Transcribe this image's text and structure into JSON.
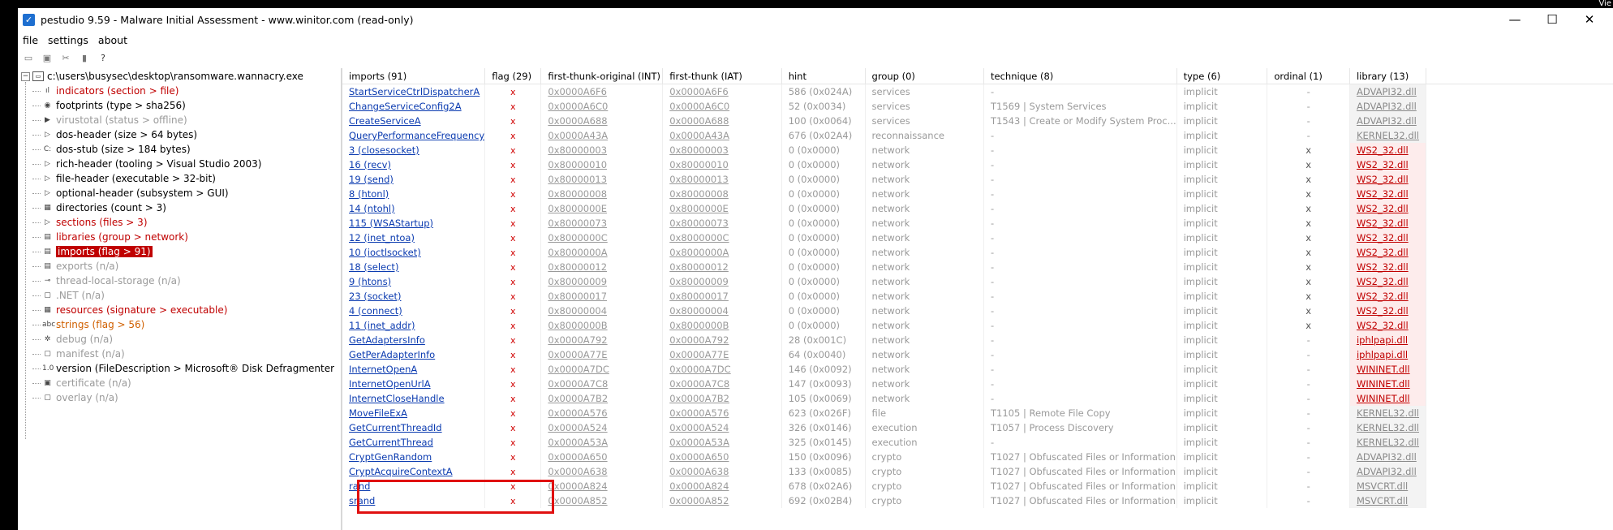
{
  "window": {
    "title": "pestudio 9.59 - Malware Initial Assessment - www.winitor.com (read-only)",
    "corner_text": "Vie",
    "controls": {
      "minimize": "—",
      "maximize": "☐",
      "close": "✕"
    }
  },
  "menu": [
    "file",
    "settings",
    "about"
  ],
  "toolbar_icons": [
    "open-icon",
    "save-icon",
    "cut-icon",
    "delete-icon",
    "help-icon"
  ],
  "tree": {
    "root": "c:\\users\\busysec\\desktop\\ransomware.wannacry.exe",
    "items": [
      {
        "label": "indicators (section > file)",
        "color": "red",
        "icon": "ıl"
      },
      {
        "label": "footprints (type > sha256)",
        "color": "black",
        "icon": "◉"
      },
      {
        "label": "virustotal (status > offline)",
        "color": "grey",
        "icon": "▶"
      },
      {
        "label": "dos-header (size > 64 bytes)",
        "color": "black",
        "icon": "▷"
      },
      {
        "label": "dos-stub (size > 184 bytes)",
        "color": "black",
        "icon": "C:"
      },
      {
        "label": "rich-header (tooling > Visual Studio 2003)",
        "color": "black",
        "icon": "▷"
      },
      {
        "label": "file-header (executable > 32-bit)",
        "color": "black",
        "icon": "▷"
      },
      {
        "label": "optional-header (subsystem > GUI)",
        "color": "black",
        "icon": "▷"
      },
      {
        "label": "directories (count > 3)",
        "color": "black",
        "icon": "▦"
      },
      {
        "label": "sections (files > 3)",
        "color": "red",
        "icon": "▷"
      },
      {
        "label": "libraries (group > network)",
        "color": "red",
        "icon": "▤"
      },
      {
        "label": "imports (flag > 91)",
        "color": "selected",
        "icon": "▤"
      },
      {
        "label": "exports (n/a)",
        "color": "grey",
        "icon": "▤"
      },
      {
        "label": "thread-local-storage (n/a)",
        "color": "grey",
        "icon": "⊸"
      },
      {
        "label": ".NET (n/a)",
        "color": "grey",
        "icon": "▢"
      },
      {
        "label": "resources (signature > executable)",
        "color": "red",
        "icon": "▦"
      },
      {
        "label": "strings (flag > 56)",
        "color": "orange",
        "icon": "abc"
      },
      {
        "label": "debug (n/a)",
        "color": "grey",
        "icon": "✲"
      },
      {
        "label": "manifest (n/a)",
        "color": "grey",
        "icon": "▢"
      },
      {
        "label": "version (FileDescription > Microsoft® Disk Defragmenter)",
        "color": "black",
        "icon": "1.0"
      },
      {
        "label": "certificate (n/a)",
        "color": "grey",
        "icon": "▣"
      },
      {
        "label": "overlay (n/a)",
        "color": "grey",
        "icon": "▢"
      }
    ]
  },
  "table": {
    "columns": [
      "imports (91)",
      "flag (29)",
      "first-thunk-original (INT)",
      "first-thunk (IAT)",
      "hint",
      "group (0)",
      "technique (8)",
      "type (6)",
      "ordinal (1)",
      "library (13)"
    ],
    "flag_mark": "x",
    "rows": [
      [
        "StartServiceCtrlDispatcherA",
        "x",
        "0x0000A6F6",
        "0x0000A6F6",
        "586 (0x024A)",
        "services",
        "-",
        "implicit",
        "-",
        "ADVAPI32.dll",
        "grey"
      ],
      [
        "ChangeServiceConfig2A",
        "x",
        "0x0000A6C0",
        "0x0000A6C0",
        "52 (0x0034)",
        "services",
        "T1569 | System Services",
        "implicit",
        "-",
        "ADVAPI32.dll",
        "grey"
      ],
      [
        "CreateServiceA",
        "x",
        "0x0000A688",
        "0x0000A688",
        "100 (0x0064)",
        "services",
        "T1543 | Create or Modify System Proc...",
        "implicit",
        "-",
        "ADVAPI32.dll",
        "grey"
      ],
      [
        "QueryPerformanceFrequency",
        "x",
        "0x0000A43A",
        "0x0000A43A",
        "676 (0x02A4)",
        "reconnaissance",
        "-",
        "implicit",
        "-",
        "KERNEL32.dll",
        "grey"
      ],
      [
        "3 (closesocket)",
        "x",
        "0x80000003",
        "0x80000003",
        "0 (0x0000)",
        "network",
        "-",
        "implicit",
        "x",
        "WS2_32.dll",
        "red"
      ],
      [
        "16 (recv)",
        "x",
        "0x80000010",
        "0x80000010",
        "0 (0x0000)",
        "network",
        "-",
        "implicit",
        "x",
        "WS2_32.dll",
        "red"
      ],
      [
        "19 (send)",
        "x",
        "0x80000013",
        "0x80000013",
        "0 (0x0000)",
        "network",
        "-",
        "implicit",
        "x",
        "WS2_32.dll",
        "red"
      ],
      [
        "8 (htonl)",
        "x",
        "0x80000008",
        "0x80000008",
        "0 (0x0000)",
        "network",
        "-",
        "implicit",
        "x",
        "WS2_32.dll",
        "red"
      ],
      [
        "14 (ntohl)",
        "x",
        "0x8000000E",
        "0x8000000E",
        "0 (0x0000)",
        "network",
        "-",
        "implicit",
        "x",
        "WS2_32.dll",
        "red"
      ],
      [
        "115 (WSAStartup)",
        "x",
        "0x80000073",
        "0x80000073",
        "0 (0x0000)",
        "network",
        "-",
        "implicit",
        "x",
        "WS2_32.dll",
        "red"
      ],
      [
        "12 (inet_ntoa)",
        "x",
        "0x8000000C",
        "0x8000000C",
        "0 (0x0000)",
        "network",
        "-",
        "implicit",
        "x",
        "WS2_32.dll",
        "red"
      ],
      [
        "10 (ioctlsocket)",
        "x",
        "0x8000000A",
        "0x8000000A",
        "0 (0x0000)",
        "network",
        "-",
        "implicit",
        "x",
        "WS2_32.dll",
        "red"
      ],
      [
        "18 (select)",
        "x",
        "0x80000012",
        "0x80000012",
        "0 (0x0000)",
        "network",
        "-",
        "implicit",
        "x",
        "WS2_32.dll",
        "red"
      ],
      [
        "9 (htons)",
        "x",
        "0x80000009",
        "0x80000009",
        "0 (0x0000)",
        "network",
        "-",
        "implicit",
        "x",
        "WS2_32.dll",
        "red"
      ],
      [
        "23 (socket)",
        "x",
        "0x80000017",
        "0x80000017",
        "0 (0x0000)",
        "network",
        "-",
        "implicit",
        "x",
        "WS2_32.dll",
        "red"
      ],
      [
        "4 (connect)",
        "x",
        "0x80000004",
        "0x80000004",
        "0 (0x0000)",
        "network",
        "-",
        "implicit",
        "x",
        "WS2_32.dll",
        "red"
      ],
      [
        "11 (inet_addr)",
        "x",
        "0x8000000B",
        "0x8000000B",
        "0 (0x0000)",
        "network",
        "-",
        "implicit",
        "x",
        "WS2_32.dll",
        "red"
      ],
      [
        "GetAdaptersInfo",
        "x",
        "0x0000A792",
        "0x0000A792",
        "28 (0x001C)",
        "network",
        "-",
        "implicit",
        "-",
        "iphlpapi.dll",
        "red"
      ],
      [
        "GetPerAdapterInfo",
        "x",
        "0x0000A77E",
        "0x0000A77E",
        "64 (0x0040)",
        "network",
        "-",
        "implicit",
        "-",
        "iphlpapi.dll",
        "red"
      ],
      [
        "InternetOpenA",
        "x",
        "0x0000A7DC",
        "0x0000A7DC",
        "146 (0x0092)",
        "network",
        "-",
        "implicit",
        "-",
        "WININET.dll",
        "red"
      ],
      [
        "InternetOpenUrlA",
        "x",
        "0x0000A7C8",
        "0x0000A7C8",
        "147 (0x0093)",
        "network",
        "-",
        "implicit",
        "-",
        "WININET.dll",
        "red"
      ],
      [
        "InternetCloseHandle",
        "x",
        "0x0000A7B2",
        "0x0000A7B2",
        "105 (0x0069)",
        "network",
        "-",
        "implicit",
        "-",
        "WININET.dll",
        "red"
      ],
      [
        "MoveFileExA",
        "x",
        "0x0000A576",
        "0x0000A576",
        "623 (0x026F)",
        "file",
        "T1105 | Remote File Copy",
        "implicit",
        "-",
        "KERNEL32.dll",
        "grey"
      ],
      [
        "GetCurrentThreadId",
        "x",
        "0x0000A524",
        "0x0000A524",
        "326 (0x0146)",
        "execution",
        "T1057 | Process Discovery",
        "implicit",
        "-",
        "KERNEL32.dll",
        "grey"
      ],
      [
        "GetCurrentThread",
        "x",
        "0x0000A53A",
        "0x0000A53A",
        "325 (0x0145)",
        "execution",
        "-",
        "implicit",
        "-",
        "KERNEL32.dll",
        "grey"
      ],
      [
        "CryptGenRandom",
        "x",
        "0x0000A650",
        "0x0000A650",
        "150 (0x0096)",
        "crypto",
        "T1027 | Obfuscated Files or Information",
        "implicit",
        "-",
        "ADVAPI32.dll",
        "grey"
      ],
      [
        "CryptAcquireContextA",
        "x",
        "0x0000A638",
        "0x0000A638",
        "133 (0x0085)",
        "crypto",
        "T1027 | Obfuscated Files or Information",
        "implicit",
        "-",
        "ADVAPI32.dll",
        "grey"
      ],
      [
        "rand",
        "x",
        "0x0000A824",
        "0x0000A824",
        "678 (0x02A6)",
        "crypto",
        "T1027 | Obfuscated Files or Information",
        "implicit",
        "-",
        "MSVCRT.dll",
        "grey"
      ],
      [
        "srand",
        "x",
        "0x0000A852",
        "0x0000A852",
        "692 (0x02B4)",
        "crypto",
        "T1027 | Obfuscated Files or Information",
        "implicit",
        "-",
        "MSVCRT.dll",
        "grey"
      ]
    ]
  }
}
